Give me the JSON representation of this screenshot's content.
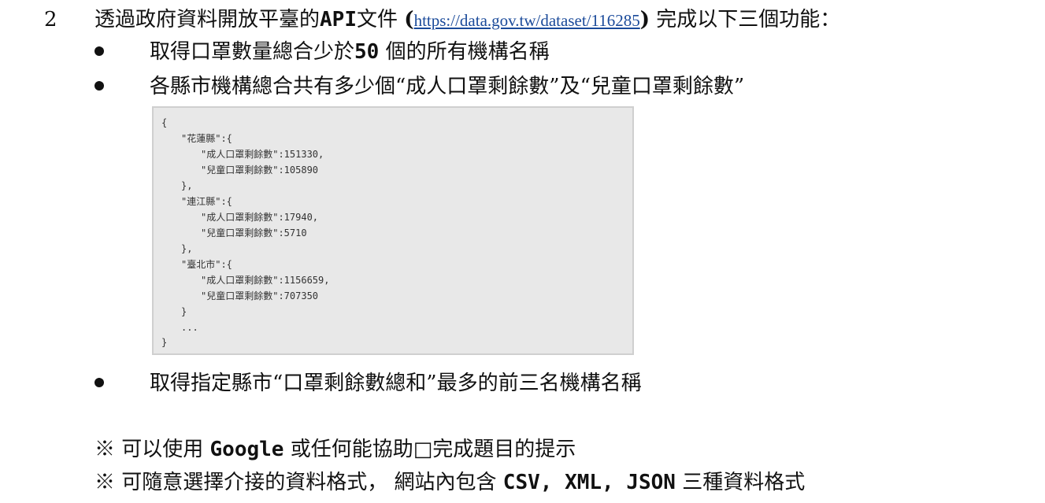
{
  "item": {
    "number": "2",
    "text_before": "透過政府資料開放平臺的",
    "api": "API",
    "text_mid": "文件 ",
    "open_paren": "(",
    "link": "https://data.gov.tw/dataset/116285",
    "close_paren": ")",
    "text_after": " 完成以下三個功能："
  },
  "bullets": [
    {
      "before": "取得口罩數量總合少於",
      "mono": "50",
      "after": " 個的所有機構名稱"
    },
    {
      "text": "各縣市機構總合共有多少個“成人口罩剩餘數”及“兒童口罩剩餘數”"
    },
    {
      "text": "取得指定縣市“口罩剩餘數總和”最多的前三名機構名稱"
    }
  ],
  "code_lines": [
    "{",
    "\"花蓮縣\":{",
    "\"成人口罩剩餘數\":151330,",
    "\"兒童口罩剩餘數\":105890",
    "},",
    "\"連江縣\":{",
    "\"成人口罩剩餘數\":17940,",
    "\"兒童口罩剩餘數\":5710",
    "},",
    "\"臺北市\":{",
    "\"成人口罩剩餘數\":1156659,",
    "\"兒童口罩剩餘數\":707350",
    "}",
    "...",
    "}"
  ],
  "notes": [
    {
      "prefix": "※ 可以使用 ",
      "mono": "Google",
      "suffix": " 或任何能協助□完成題目的提示"
    },
    {
      "prefix": "※ 可隨意選擇介接的資料格式， 網站內包含 ",
      "mono": "CSV, XML, JSON",
      "suffix": " 三種資料格式"
    }
  ]
}
